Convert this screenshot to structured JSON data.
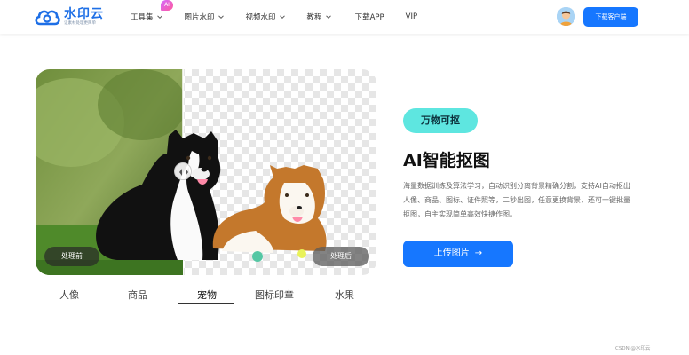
{
  "header": {
    "logo": {
      "name": "水印云",
      "slogan": "让素材处理更简单"
    },
    "nav": [
      {
        "label": "工具集",
        "has_dropdown": true,
        "badge": "AI"
      },
      {
        "label": "图片水印",
        "has_dropdown": true
      },
      {
        "label": "视频水印",
        "has_dropdown": true
      },
      {
        "label": "教程",
        "has_dropdown": true
      },
      {
        "label": "下载APP",
        "has_dropdown": false
      },
      {
        "label": "VIP",
        "has_dropdown": false
      }
    ],
    "download_button": "下载客户端"
  },
  "showcase": {
    "before_label": "处理前",
    "after_label": "处理后",
    "categories": [
      "人像",
      "商品",
      "宠物",
      "图标印章",
      "水果"
    ],
    "active_category": "宠物"
  },
  "feature": {
    "pill": "万物可抠",
    "title": "AI智能抠图",
    "description": "海量数据训练及算法学习，自动识别分离背景精确分割，支持AI自动抠出人像、商品、图标、证件照等，二秒出图，任意更换背景，还可一键批量抠图，自主实现简单高效快捷作图。",
    "upload_button": "上传图片",
    "upload_arrow": "→"
  },
  "footer": {
    "watermark": "CSDN @水印云"
  },
  "colors": {
    "primary": "#1677ff",
    "pill_bg": "#5ee6e0",
    "logo": "#1e6fe6"
  }
}
